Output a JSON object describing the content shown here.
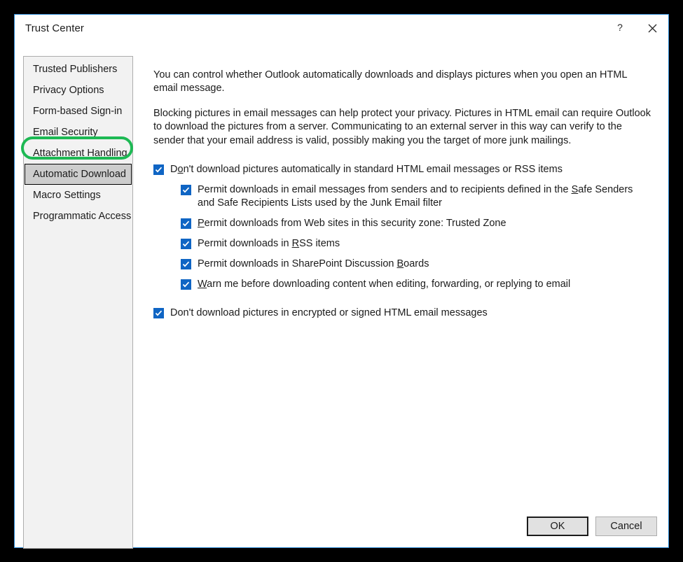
{
  "window": {
    "title": "Trust Center",
    "help_icon": "question-mark-icon",
    "close_icon": "close-icon"
  },
  "sidebar": {
    "items": [
      {
        "label": "Trusted Publishers",
        "selected": false,
        "highlighted": false
      },
      {
        "label": "Privacy Options",
        "selected": false,
        "highlighted": false
      },
      {
        "label": "Form-based Sign-in",
        "selected": false,
        "highlighted": false
      },
      {
        "label": "Email Security",
        "selected": false,
        "highlighted": true
      },
      {
        "label": "Attachment Handling",
        "selected": false,
        "highlighted": false
      },
      {
        "label": "Automatic Download",
        "selected": true,
        "highlighted": false
      },
      {
        "label": "Macro Settings",
        "selected": false,
        "highlighted": false
      },
      {
        "label": "Programmatic Access",
        "selected": false,
        "highlighted": false
      }
    ],
    "annotation_color": "#1db954"
  },
  "content": {
    "paragraph1": "You can control whether Outlook automatically downloads and displays pictures when you open an HTML email message.",
    "paragraph2": "Blocking pictures in email messages can help protect your privacy. Pictures in HTML email can require Outlook to download the pictures from a server. Communicating to an external server in this way can verify to the sender that your email address is valid, possibly making you the target of more junk mailings.",
    "options": [
      {
        "id": "dont-download-pictures-automatically",
        "label_pre": "D",
        "label_accel": "o",
        "label_post": "n't download pictures automatically in standard HTML email messages or RSS items",
        "checked": true,
        "level": 0
      },
      {
        "id": "permit-downloads-safe-senders",
        "label_pre": "Permit downloads in email messages from senders and to recipients defined in the ",
        "label_accel": "S",
        "label_post": "afe Senders and Safe Recipients Lists used by the Junk Email filter",
        "checked": true,
        "level": 1
      },
      {
        "id": "permit-downloads-web-sites-security-zone",
        "label_pre": "",
        "label_accel": "P",
        "label_post": "ermit downloads from Web sites in this security zone: Trusted Zone",
        "checked": true,
        "level": 1
      },
      {
        "id": "permit-downloads-rss-items",
        "label_pre": "Permit downloads in ",
        "label_accel": "R",
        "label_post": "SS items",
        "checked": true,
        "level": 1
      },
      {
        "id": "permit-downloads-sharepoint-discussion-boards",
        "label_pre": "Permit downloads in SharePoint Discussion ",
        "label_accel": "B",
        "label_post": "oards",
        "checked": true,
        "level": 1
      },
      {
        "id": "warn-before-downloading-content",
        "label_pre": "",
        "label_accel": "W",
        "label_post": "arn me before downloading content when editing, forwarding, or replying to email",
        "checked": true,
        "level": 1
      },
      {
        "id": "dont-download-pictures-encrypted-signed",
        "label_pre": "Don't download pictures in encrypted or signed HTML email messages",
        "label_accel": "",
        "label_post": "",
        "checked": true,
        "level": 0
      }
    ]
  },
  "footer": {
    "ok_label": "OK",
    "cancel_label": "Cancel"
  },
  "colors": {
    "window_border": "#2a8ad4",
    "checkbox_blue": "#0f65c4",
    "selected_nav_bg": "#cdcdcd",
    "annotation_green": "#1db954",
    "backdrop": "#000000"
  }
}
